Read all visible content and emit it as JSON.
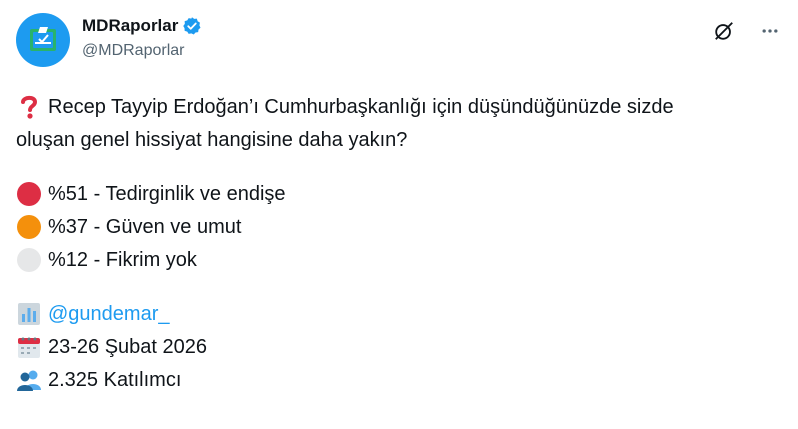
{
  "author": {
    "display_name": "MDRaporlar",
    "handle": "@MDRaporlar",
    "verified_icon": "verified-badge-icon",
    "avatar_color": "#1d9bf0"
  },
  "actions": {
    "grok_icon": "grok-icon",
    "more_icon": "more-dots-icon"
  },
  "post": {
    "question_line1": "Recep Tayyip Erdoğan’ı Cumhurbaşkanlığı için düşündüğünüzde sizde",
    "question_line2": "oluşan genel hissiyat hangisine daha yakın?",
    "options": [
      {
        "text": "%51 - Tedirginlik ve endişe",
        "color": "#dd2e44"
      },
      {
        "text": "%37 - Güven ve umut",
        "color": "#f4900c"
      },
      {
        "text": "%12 - Fikrim yok",
        "color": "#e6e7e8"
      }
    ],
    "mention": "@gundemar_",
    "date": "23-26 Şubat 2026",
    "participants": "2.325 Katılımcı"
  }
}
